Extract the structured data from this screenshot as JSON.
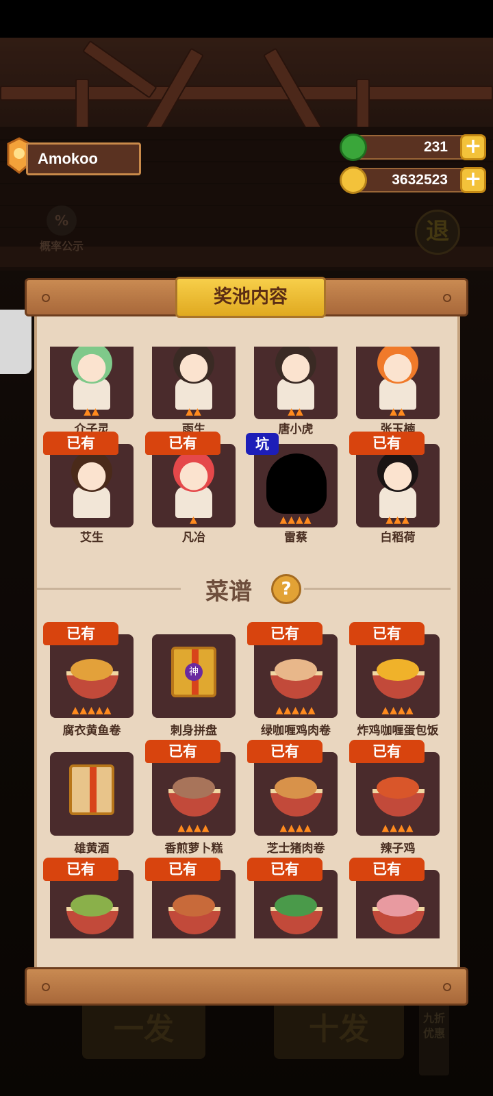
{
  "player": {
    "name": "Amokoo"
  },
  "resources": {
    "jade": "231",
    "coins": "3632523",
    "plus_label": "+"
  },
  "background": {
    "prob_icon": "%",
    "prob_label": "概率公示",
    "exit_label": "退",
    "single_draw": "一发",
    "ten_draw": "十发",
    "discount": "九折优惠"
  },
  "panel": {
    "title": "奖池内容",
    "recipe_section": "菜谱",
    "help_icon": "?",
    "owned_label": "已有",
    "pit_label": "坑",
    "divine_label": "神",
    "characters": [
      {
        "name": "介子灵",
        "owned": false,
        "stars": 2,
        "hair": "#7fc98a"
      },
      {
        "name": "雨生",
        "owned": false,
        "stars": 2,
        "hair": "#3a2a24"
      },
      {
        "name": "唐小虎",
        "owned": false,
        "stars": 2,
        "hair": "#3a2a24"
      },
      {
        "name": "张玉楠",
        "owned": false,
        "stars": 2,
        "hair": "#f07a2a"
      },
      {
        "name": "艾生",
        "owned": true,
        "stars": 0,
        "hair": "#4a2a1a"
      },
      {
        "name": "凡冶",
        "owned": true,
        "stars": 1,
        "hair": "#e5484a"
      },
      {
        "name": "雷蔡",
        "owned": false,
        "pit": true,
        "stars": 4,
        "hair": "#000000"
      },
      {
        "name": "白稻荷",
        "owned": true,
        "stars": 3,
        "hair": "#1a1414"
      }
    ],
    "recipes": [
      {
        "name": "腐衣黄鱼卷",
        "owned": true,
        "stars": 5,
        "color": "#e3a13a"
      },
      {
        "name": "刺身拼盘",
        "owned": false,
        "stars": 0,
        "color": "#e0a830",
        "gift": true
      },
      {
        "name": "绿咖喱鸡肉卷",
        "owned": true,
        "stars": 5,
        "color": "#e8b78a"
      },
      {
        "name": "炸鸡咖喱蛋包饭",
        "owned": true,
        "stars": 4,
        "color": "#f0b22a"
      },
      {
        "name": "雄黄酒",
        "owned": false,
        "stars": 0,
        "color": "#e8c48a",
        "gift": true
      },
      {
        "name": "香煎萝卜糕",
        "owned": true,
        "stars": 4,
        "color": "#a8745a"
      },
      {
        "name": "芝士猪肉卷",
        "owned": true,
        "stars": 4,
        "color": "#d8924a"
      },
      {
        "name": "辣子鸡",
        "owned": true,
        "stars": 4,
        "color": "#d9562a"
      },
      {
        "name": "",
        "owned": true,
        "stars": 0,
        "color": "#8ab04a"
      },
      {
        "name": "",
        "owned": true,
        "stars": 0,
        "color": "#c86a3a"
      },
      {
        "name": "",
        "owned": true,
        "stars": 0,
        "color": "#4a9a4a"
      },
      {
        "name": "",
        "owned": true,
        "stars": 0,
        "color": "#e89aa0"
      }
    ]
  }
}
